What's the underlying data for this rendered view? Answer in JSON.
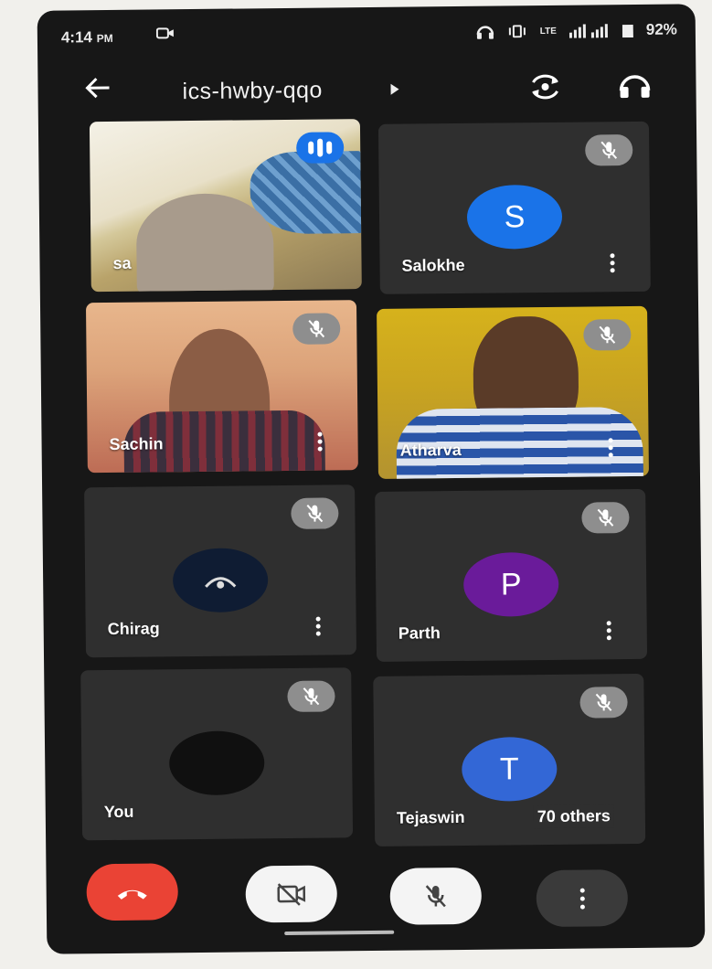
{
  "status_bar": {
    "time": "4:14",
    "ampm": "PM",
    "network_text": "LTE",
    "battery": "92%"
  },
  "meeting": {
    "code": "ics-hwby-qqo"
  },
  "participants": [
    {
      "name": "sa",
      "type": "video",
      "speaking": true
    },
    {
      "name": "Salokhe",
      "type": "avatar",
      "initial": "S",
      "color": "#1a73e8",
      "muted": true
    },
    {
      "name": "Sachin",
      "type": "video",
      "muted": true
    },
    {
      "name": "Atharva",
      "type": "video",
      "muted": true
    },
    {
      "name": "Chirag",
      "type": "avatar",
      "initial": "",
      "color": "#0f1c33",
      "muted": true
    },
    {
      "name": "Parth",
      "type": "avatar",
      "initial": "P",
      "color": "#6a1b9a",
      "muted": true
    },
    {
      "name": "You",
      "type": "avatar",
      "initial": "",
      "color": "#101010",
      "muted": true
    },
    {
      "name": "Tejaswin",
      "type": "avatar",
      "initial": "T",
      "color": "#3367d6",
      "muted": true,
      "others_label": "70 others"
    }
  ],
  "controls": {
    "end_call_color": "#ea4335",
    "camera_icon": "camera-off-icon",
    "mic_icon": "mic-off-icon",
    "more_icon": "more-vert-icon"
  }
}
